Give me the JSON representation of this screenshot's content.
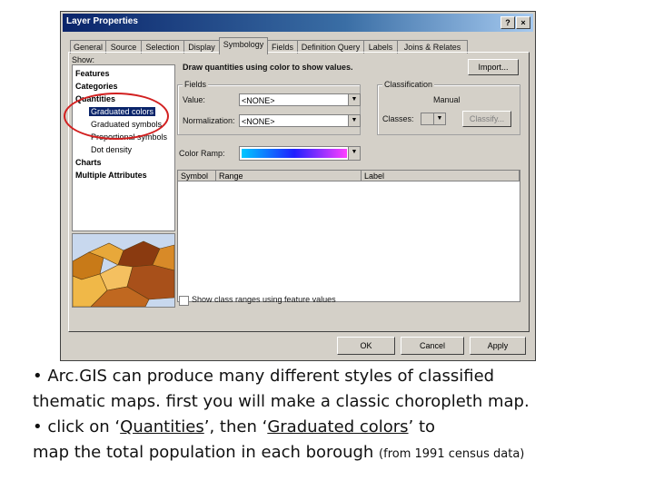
{
  "window": {
    "title": "Layer Properties",
    "help_btn": "?",
    "close_btn": "×"
  },
  "tabs": [
    "General",
    "Source",
    "Selection",
    "Display",
    "Symbology",
    "Fields",
    "Definition Query",
    "Labels",
    "Joins & Relates"
  ],
  "active_tab": "Symbology",
  "show": {
    "label": "Show:",
    "items": [
      "Features",
      "Categories",
      "Quantities",
      "Graduated colors",
      "Graduated symbols",
      "Proportional symbols",
      "Dot density",
      "Charts",
      "Multiple Attributes"
    ],
    "selected": "Graduated colors"
  },
  "header_text": "Draw quantities using color to show values.",
  "import_btn": "Import...",
  "fields": {
    "group": "Fields",
    "value_label": "Value:",
    "value": "<NONE>",
    "normalization_label": "Normalization:",
    "normalization": "<NONE>"
  },
  "classification": {
    "group": "Classification",
    "method": "Manual",
    "classes_label": "Classes:",
    "classify_btn": "Classify..."
  },
  "color_ramp_label": "Color Ramp:",
  "grid_headers": [
    "Symbol",
    "Range",
    "Label"
  ],
  "show_ranges": "Show class ranges using feature values",
  "buttons": {
    "ok": "OK",
    "cancel": "Cancel",
    "apply": "Apply"
  },
  "caption": {
    "line1": "• Arc.GIS can produce many different styles of classified",
    "line2": "thematic maps. first you will make a classic choropleth map.",
    "line3_pre": "• click on ‘",
    "line3_q": "Quantities",
    "line3_mid": "’, then ‘",
    "line3_g": "Graduated colors",
    "line3_post": "’ to",
    "line4": "map the total population in each borough ",
    "line4_small": "(from 1991 census data)"
  },
  "colors": {
    "ramp_start": "#00c8ff",
    "ramp_mid": "#2020ff",
    "ramp_end": "#ff40ff",
    "highlight_ring": "#d22020"
  }
}
